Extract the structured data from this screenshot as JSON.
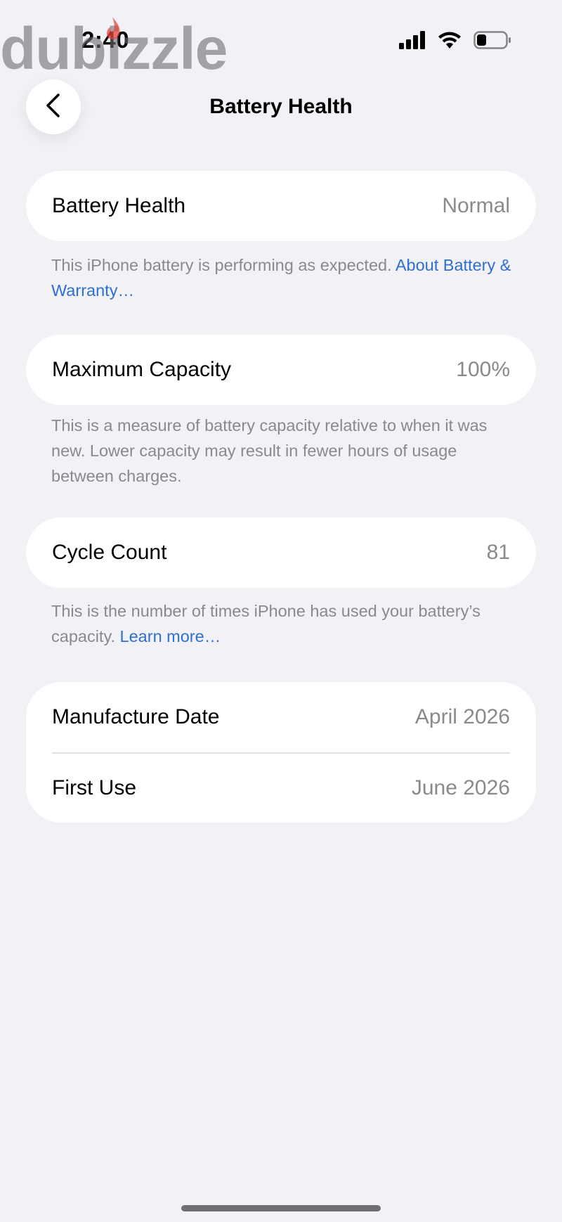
{
  "watermark": {
    "text": "dubizzle",
    "accent": "#e4453b"
  },
  "status_bar": {
    "time": "2:40",
    "icons": [
      "cellular-signal-icon",
      "wifi-icon",
      "battery-icon"
    ]
  },
  "nav": {
    "title": "Battery Health",
    "back_icon": "chevron-left-icon"
  },
  "sections": {
    "health": {
      "label": "Battery Health",
      "value": "Normal",
      "footnote_text": "This iPhone battery is performing as expected. ",
      "footnote_link": "About Battery & Warranty…"
    },
    "capacity": {
      "label": "Maximum Capacity",
      "value": "100%",
      "footnote_text": "This is a measure of battery capacity relative to when it was new. Lower capacity may result in fewer hours of usage between charges."
    },
    "cycle": {
      "label": "Cycle Count",
      "value": "81",
      "footnote_text": "This is the number of times iPhone has used your battery’s capacity. ",
      "footnote_link": "Learn more…"
    },
    "dates": {
      "manufacture_label": "Manufacture Date",
      "manufacture_value": "April 2026",
      "first_use_label": "First Use",
      "first_use_value": "June 2026"
    }
  },
  "colors": {
    "background": "#f1f1f6",
    "link": "#2f6fd1",
    "secondary_text": "#8a8a8e"
  }
}
